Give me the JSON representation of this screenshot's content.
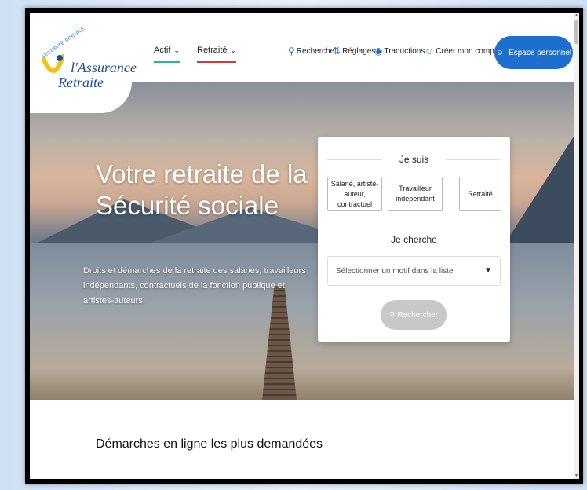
{
  "header": {
    "logo": {
      "tagline": "SÉCURITÉ SOCIALE",
      "line1": "l'Assurance",
      "line2": "Retraite"
    },
    "nav": [
      {
        "label": "Actif",
        "underline_color": "#2bb0a0"
      },
      {
        "label": "Retraité",
        "underline_color": "#d23b3b"
      }
    ],
    "tools": {
      "search": "Recherche",
      "settings": "Réglages",
      "translations": "Traductions",
      "create_account": "Créer mon compte"
    },
    "espace_button": "Espace personnel"
  },
  "hero": {
    "title": "Votre retraite de la Sécurité sociale",
    "description": "Droits et démarches de la retraite des salariés, travailleurs indépendants, contractuels de la fonction publique et artistes-auteurs."
  },
  "card": {
    "je_suis": "Je suis",
    "choices": [
      "Salarié, artiste-auteur, contractuel",
      "Travailleur indépendant",
      "Retraité"
    ],
    "je_cherche": "Je cherche",
    "select_placeholder": "Sélectionner un motif dans la liste",
    "search_button": "Rechercher"
  },
  "section": {
    "title": "Démarches en ligne les plus demandées"
  },
  "colors": {
    "brand_blue": "#1c6fcf",
    "logo_yellow": "#f2c21b",
    "disabled_button": "#c8c8c8"
  }
}
